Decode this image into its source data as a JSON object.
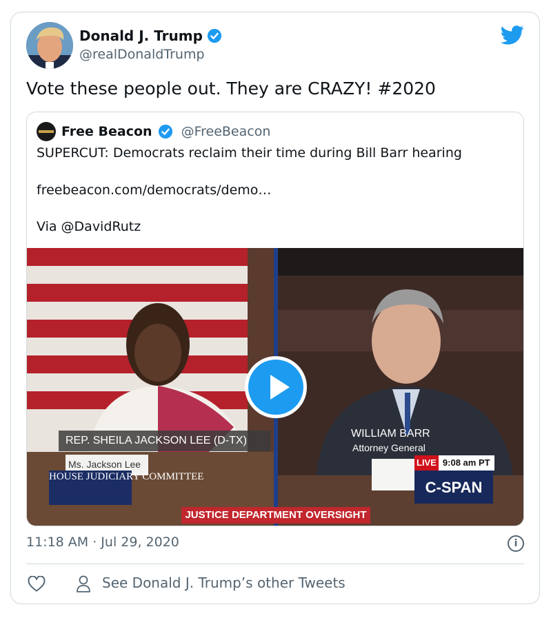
{
  "tweet": {
    "author_name": "Donald J. Trump",
    "author_handle": "@realDonaldTrump",
    "text": "Vote these people out. They are CRAZY!  #2020",
    "timestamp": "11:18 AM · Jul 29, 2020",
    "other_tweets_label": "See Donald J. Trump’s other Tweets"
  },
  "quoted": {
    "author_name": "Free Beacon",
    "author_handle": "@FreeBeacon",
    "line1": "SUPERCUT: Democrats reclaim their time during Bill Barr hearing",
    "line2": "freebeacon.com/democrats/demo…",
    "line3": "Via @DavidRutz"
  },
  "video": {
    "lower_third_left": "REP. SHEILA JACKSON LEE (D-TX)",
    "nameplate_left": "Ms. Jackson Lee",
    "right_name": "WILLIAM BARR",
    "right_title": "Attorney General",
    "committee": "HOUSE JUDICIARY COMMITTEE",
    "banner": "JUSTICE DEPARTMENT OVERSIGHT",
    "live_label": "LIVE",
    "live_time": "9:08 am PT",
    "network": "C-SPAN"
  },
  "colors": {
    "accent": "#1d9bf0",
    "text": "#0f1419",
    "muted": "#536471",
    "border": "#cfd9de"
  },
  "icons": [
    "verified-badge-icon",
    "twitter-bird-icon",
    "play-icon",
    "info-icon",
    "heart-icon",
    "person-icon"
  ]
}
